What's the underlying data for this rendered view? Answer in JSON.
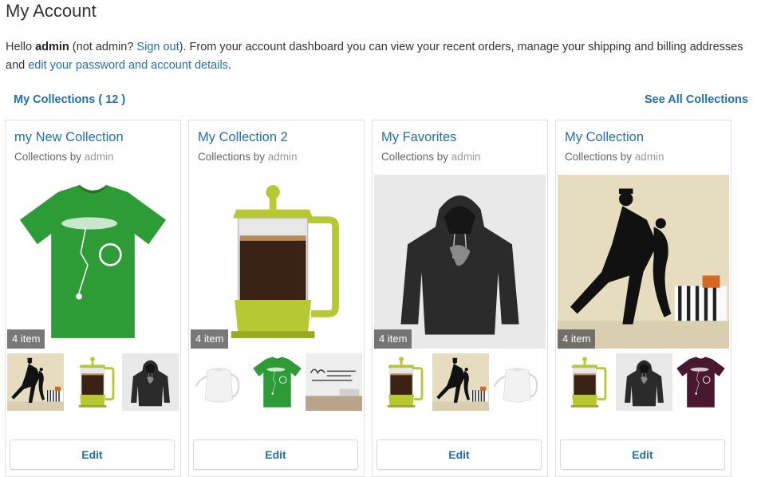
{
  "page": {
    "title": "My Account",
    "intro": {
      "hello": "Hello ",
      "username": "admin",
      "not_user_pre": " (not admin? ",
      "sign_out": "Sign out",
      "middle": "). From your account dashboard you can view your recent orders, manage your shipping and billing addresses and ",
      "edit_link": "edit your password and account details",
      "end": "."
    }
  },
  "collections": {
    "heading": "My Collections ( 12 )",
    "see_all": "See All Collections",
    "by_label": "Collections by ",
    "cards": [
      {
        "title": "my New Collection",
        "author": "admin",
        "count": "4 item",
        "edit": "Edit",
        "main": "green-tshirt",
        "thumbs": [
          "dancer-wall-art",
          "french-press",
          "black-hoodie"
        ]
      },
      {
        "title": "My Collection 2",
        "author": "admin",
        "count": "4 item",
        "edit": "Edit",
        "main": "french-press",
        "thumbs": [
          "white-kettle",
          "green-tshirt",
          "wall-quote-decal"
        ]
      },
      {
        "title": "My Favorites",
        "author": "admin",
        "count": "4 item",
        "edit": "Edit",
        "main": "black-hoodie",
        "thumbs": [
          "french-press",
          "dancer-wall-art",
          "white-kettle"
        ]
      },
      {
        "title": "My Collection",
        "author": "admin",
        "count": "4 item",
        "edit": "Edit",
        "main": "dancer-wall-art",
        "thumbs": [
          "french-press",
          "black-hoodie",
          "purple-tshirt"
        ]
      }
    ]
  },
  "colors": {
    "link": "#1f6fb2",
    "tshirt_green": "#2e9c36",
    "tshirt_purple": "#4a1730",
    "press_lime": "#b8c832",
    "hoodie": "#2b2b2b",
    "wall_beige": "#e6dcc0"
  }
}
